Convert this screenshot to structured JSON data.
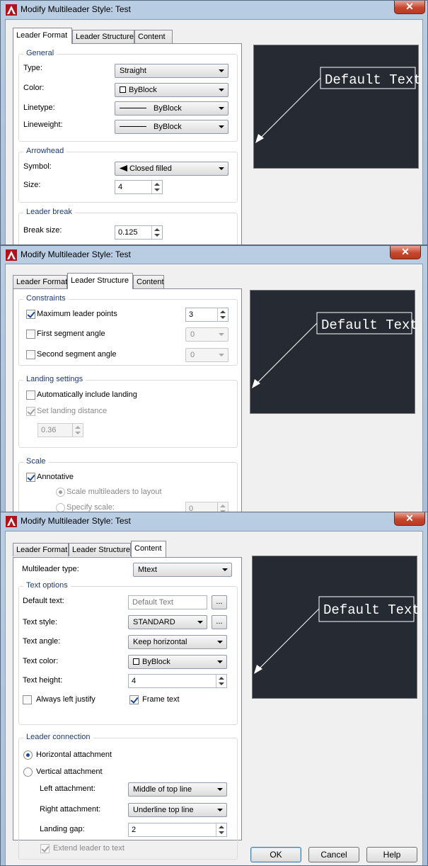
{
  "dialog1": {
    "title": "Modify Multileader Style: Test",
    "close": "✕",
    "tabs": [
      "Leader Format",
      "Leader Structure",
      "Content"
    ],
    "active_tab": "Leader Format",
    "general": {
      "label": "General",
      "type_label": "Type:",
      "type_value": "Straight",
      "color_label": "Color:",
      "color_value": "ByBlock",
      "linetype_label": "Linetype:",
      "linetype_value": "ByBlock",
      "lineweight_label": "Lineweight:",
      "lineweight_value": "ByBlock"
    },
    "arrowhead": {
      "label": "Arrowhead",
      "symbol_label": "Symbol:",
      "symbol_value": "Closed filled",
      "size_label": "Size:",
      "size_value": "4"
    },
    "leader_break": {
      "label": "Leader break",
      "break_size_label": "Break size:",
      "break_size_value": "0.125"
    },
    "preview_text": "Default Text"
  },
  "dialog2": {
    "title": "Modify Multileader Style: Test",
    "close": "✕",
    "tabs": [
      "Leader Format",
      "Leader Structure",
      "Content"
    ],
    "active_tab": "Leader Structure",
    "constraints": {
      "label": "Constraints",
      "max_points_label": "Maximum leader points",
      "max_points_checked": true,
      "max_points_value": "3",
      "first_angle_label": "First segment angle",
      "first_angle_checked": false,
      "first_angle_value": "0",
      "second_angle_label": "Second segment angle",
      "second_angle_checked": false,
      "second_angle_value": "0"
    },
    "landing": {
      "label": "Landing settings",
      "auto_landing_label": "Automatically include landing",
      "auto_landing_checked": false,
      "set_distance_label": "Set landing distance",
      "set_distance_checked": true,
      "distance_value": "0.36"
    },
    "scale": {
      "label": "Scale",
      "annotative_label": "Annotative",
      "annotative_checked": true,
      "scale_layout_label": "Scale multileaders to layout",
      "specify_scale_label": "Specify scale:",
      "specify_scale_value": "0"
    },
    "preview_text": "Default Text"
  },
  "dialog3": {
    "title": "Modify Multileader Style: Test",
    "close": "✕",
    "tabs": [
      "Leader Format",
      "Leader Structure",
      "Content"
    ],
    "active_tab": "Content",
    "multileader_type_label": "Multileader type:",
    "multileader_type_value": "Mtext",
    "text_options": {
      "label": "Text options",
      "default_text_label": "Default text:",
      "default_text_value": "Default Text",
      "ellipsis": "...",
      "text_style_label": "Text style:",
      "text_style_value": "STANDARD",
      "text_angle_label": "Text angle:",
      "text_angle_value": "Keep horizontal",
      "text_color_label": "Text color:",
      "text_color_value": "ByBlock",
      "text_height_label": "Text height:",
      "text_height_value": "4",
      "always_left_label": "Always left justify",
      "always_left_checked": false,
      "frame_text_label": "Frame text",
      "frame_text_checked": true
    },
    "leader_connection": {
      "label": "Leader connection",
      "horizontal_label": "Horizontal attachment",
      "horizontal_selected": true,
      "vertical_label": "Vertical attachment",
      "left_attach_label": "Left attachment:",
      "left_attach_value": "Middle of top line",
      "right_attach_label": "Right attachment:",
      "right_attach_value": "Underline top line",
      "landing_gap_label": "Landing gap:",
      "landing_gap_value": "2",
      "extend_label": "Extend leader to text",
      "extend_checked": true
    },
    "preview_text": "Default Text",
    "buttons": {
      "ok": "OK",
      "cancel": "Cancel",
      "help": "Help"
    }
  },
  "colors": {
    "preview_bg": "#262b33",
    "titlebar": "#b9cde3",
    "close_button": "#c4462c"
  }
}
